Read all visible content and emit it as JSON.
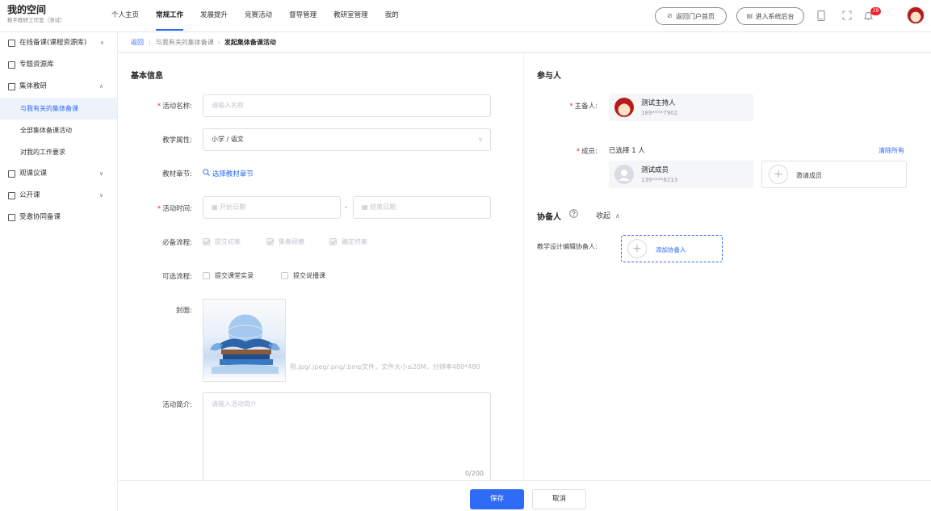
{
  "brand": {
    "title": "我的空间",
    "subtitle": "数字教研工作室（测试）"
  },
  "nav": {
    "items": [
      "个人主页",
      "常规工作",
      "发展提升",
      "竞赛活动",
      "督导管理",
      "教研室管理",
      "我的"
    ],
    "active_index": 1
  },
  "header": {
    "portal_label": "返回门户首页",
    "admin_label": "进入系统后台",
    "notification_count": "29"
  },
  "sidebar": {
    "items": [
      {
        "label": "在线备课(课程资源库)"
      },
      {
        "label": "专题资源库"
      },
      {
        "label": "集体教研"
      },
      {
        "label": "与我有关的集体备课"
      },
      {
        "label": "全部集体备课活动"
      },
      {
        "label": "对我的工作要求"
      },
      {
        "label": "观课议课"
      },
      {
        "label": "公开课"
      },
      {
        "label": "受邀协同备课"
      }
    ],
    "active_item": "与我有关的集体备课"
  },
  "breadcrumb": {
    "back": "返回",
    "parent": "与我有关的集体备课",
    "current": "发起集体备课活动"
  },
  "basic": {
    "title": "基本信息",
    "name_label": "活动名称:",
    "name_placeholder": "请输入名称",
    "attr_label": "教学属性:",
    "attr_value": "小学 / 语文",
    "chapter_label": "教材章节:",
    "chapter_link": "选择教材章节",
    "time_label": "活动时间:",
    "start_placeholder": "开始日期",
    "end_placeholder": "结束日期",
    "time_sep": "-",
    "required_label": "必备流程:",
    "required_options": [
      "提交初案",
      "集备研磨",
      "确定终案"
    ],
    "optional_label": "可选流程:",
    "optional_options": [
      "提交课堂实录",
      "提交说播课"
    ],
    "cover_label": "封面:",
    "cover_hint": "限.jpg/.jpeg/.png/.bmp文件，文件大小≤20M，分辨率480*480",
    "intro_label": "活动简介:",
    "intro_placeholder": "请输入活动简介",
    "intro_counter": "0/200"
  },
  "participants": {
    "title": "参与人",
    "host_label": "主备人:",
    "host_name": "测试主持人",
    "host_phone": "189****7902",
    "member_label": "成员:",
    "member_count_text": "已选择 1 人",
    "clear_all": "清除所有",
    "member_name": "测试成员",
    "member_phone": "139****8213",
    "invite_label": "邀请成员"
  },
  "assist": {
    "title": "协备人",
    "collapse_label": "收起",
    "editor_label": "教学设计编辑协备人:",
    "add_label": "添加协备人"
  },
  "footer": {
    "save": "保存",
    "cancel": "取消"
  },
  "colors": {
    "accent": "#2e6bf6",
    "required": "#f5222d"
  }
}
